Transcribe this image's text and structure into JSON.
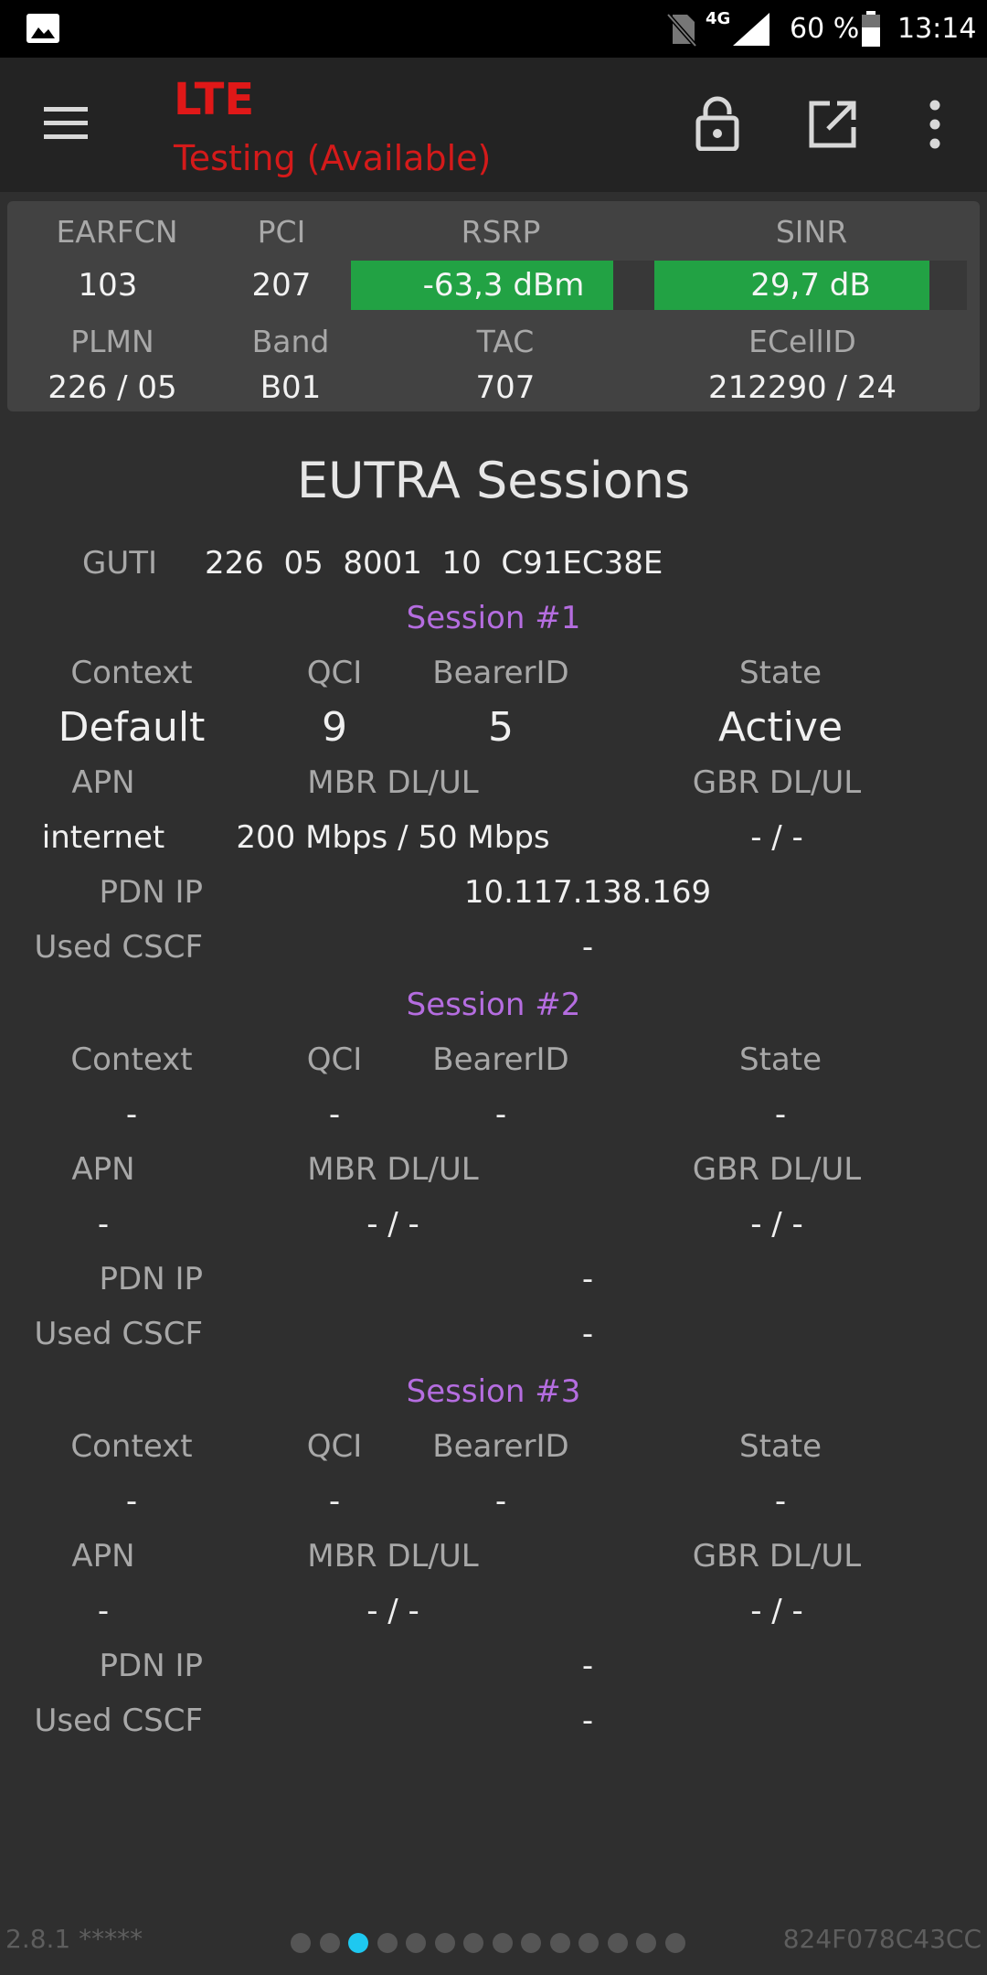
{
  "status_bar": {
    "network": "4G",
    "battery": "60 %",
    "time": "13:14"
  },
  "app_bar": {
    "title": "LTE",
    "subtitle": "Testing (Available)"
  },
  "cell_info": {
    "labels": {
      "earfcn": "EARFCN",
      "pci": "PCI",
      "rsrp": "RSRP",
      "sinr": "SINR",
      "plmn": "PLMN",
      "band": "Band",
      "tac": "TAC",
      "ecellid": "ECellID"
    },
    "values": {
      "earfcn": "103",
      "pci": "207",
      "rsrp": "-63,3 dBm",
      "sinr": "29,7 dB",
      "plmn": "226 / 05",
      "band": "B01",
      "tac": "707",
      "ecellid": "212290 / 24"
    },
    "rsrp_level": 0.86,
    "sinr_level": 0.88,
    "meter_color": "#22a244"
  },
  "eutra": {
    "heading": "EUTRA Sessions",
    "guti_label": "GUTI",
    "guti_value": "226  05  8001  10  C91EC38E",
    "field_labels": {
      "context": "Context",
      "qci": "QCI",
      "bearer_id": "BearerID",
      "state": "State",
      "apn": "APN",
      "mbr": "MBR DL/UL",
      "gbr": "GBR DL/UL",
      "pdn_ip": "PDN IP",
      "used_cscf": "Used CSCF"
    },
    "sessions": [
      {
        "title": "Session #1",
        "context": "Default",
        "qci": "9",
        "bearer_id": "5",
        "state": "Active",
        "apn": "internet",
        "mbr": "200 Mbps / 50 Mbps",
        "gbr": "- / -",
        "pdn_ip": "10.117.138.169",
        "used_cscf": "-"
      },
      {
        "title": "Session #2",
        "context": "-",
        "qci": "-",
        "bearer_id": "-",
        "state": "-",
        "apn": "-",
        "mbr": "- / -",
        "gbr": "- / -",
        "pdn_ip": "-",
        "used_cscf": "-"
      },
      {
        "title": "Session #3",
        "context": "-",
        "qci": "-",
        "bearer_id": "-",
        "state": "-",
        "apn": "-",
        "mbr": "- / -",
        "gbr": "- / -",
        "pdn_ip": "-",
        "used_cscf": "-"
      }
    ]
  },
  "footer": {
    "version": "2.8.1 *****",
    "device_id": "824F078C43CC",
    "page_count": 14,
    "active_page": 3,
    "accent": "#1ec8f0"
  }
}
